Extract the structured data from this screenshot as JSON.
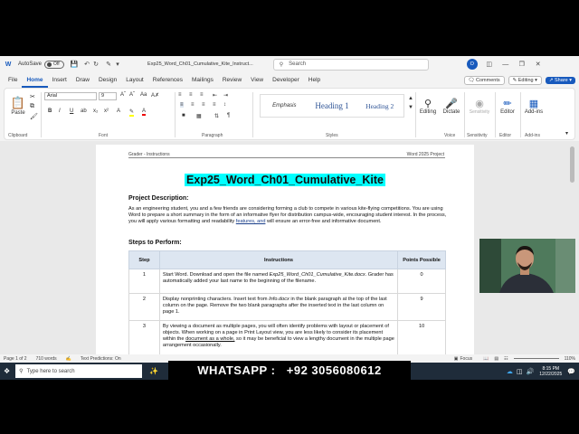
{
  "titlebar": {
    "autosave_label": "AutoSave",
    "autosave_state": "Off",
    "filename": "Exp25_Word_Ch01_Cumulative_Kite_Instruct...",
    "search_placeholder": "Search",
    "avatar_initial": "O"
  },
  "tabs": [
    "File",
    "Home",
    "Insert",
    "Draw",
    "Design",
    "Layout",
    "References",
    "Mailings",
    "Review",
    "View",
    "Developer",
    "Help"
  ],
  "right_buttons": {
    "comments": "Comments",
    "editing": "Editing",
    "share": "Share"
  },
  "ribbon": {
    "paste": "Paste",
    "clipboard": "Clipboard",
    "font_name": "Arial",
    "font_size": "9",
    "font": "Font",
    "paragraph": "Paragraph",
    "styles": "Styles",
    "style_emphasis": "Emphasis",
    "style_h1": "Heading 1",
    "style_h2": "Heading 2",
    "editing": "Editing",
    "dictate": "Dictate",
    "voice": "Voice",
    "sensitivity": "Sensitivity",
    "sensitivity_group": "Sensitivity",
    "editor": "Editor",
    "editor_group": "Editor",
    "addins": "Add-ins",
    "addins_group": "Add-ins"
  },
  "document": {
    "header_left": "Grader - Instructions",
    "header_right": "Word 2025 Project",
    "title": "Exp25_Word_Ch01_Cumulative_Kite",
    "desc_heading": "Project Description:",
    "desc_text_1": "As an engineering student, you and a few friends are considering forming a club to compete in various kite-flying competitions. You are using Word to prepare a short summary in the form of an informative flyer for distribution campus-wide, encouraging student interest. In the process, you will apply various formatting and readability ",
    "desc_link": "features, and",
    "desc_text_2": " will ensure an error-free and informative document.",
    "steps_heading": "Steps to Perform:",
    "table_headers": {
      "step": "Step",
      "instructions": "Instructions",
      "points": "Points Possible"
    },
    "rows": [
      {
        "step": "1",
        "pre": "Start Word. Download and open the file named ",
        "em": "Exp25_Word_Ch01_Cumulative_Kite.docx",
        "post": ". Grader has automatically added your last name to the beginning of the filename.",
        "points": "0"
      },
      {
        "step": "2",
        "pre": "Display nonprinting characters. Insert text from ",
        "em": "Info.docx",
        "post": " in the blank paragraph at the top of the last column on the page. Remove the two blank paragraphs after the inserted text in the last column on page 1.",
        "points": "9"
      },
      {
        "step": "3",
        "pre": "By viewing a document as multiple pages, you will often identify problems with layout or placement of objects. When working on a page in Print Layout view, you are less likely to consider its placement within the ",
        "em": "document as a whole,",
        "post": " so it may be beneficial to view a lengthy document in the multiple page arrangement occasionally.",
        "points": "10"
      }
    ]
  },
  "status": {
    "page": "Page 1 of 2",
    "words": "710 words",
    "predictions": "Text Predictions: On",
    "focus": "Focus",
    "zoom": "110%"
  },
  "taskbar": {
    "search_placeholder": "Type here to search",
    "time": "8:15 PM",
    "date": "12/22/2025"
  },
  "overlay": {
    "text": "WHATSAPP :   +92 3056080612"
  },
  "colors": {
    "accent": "#185abd",
    "title_highlight": "#00ffff",
    "table_header": "#dde6f1",
    "taskbar": "#1f2c3a"
  }
}
